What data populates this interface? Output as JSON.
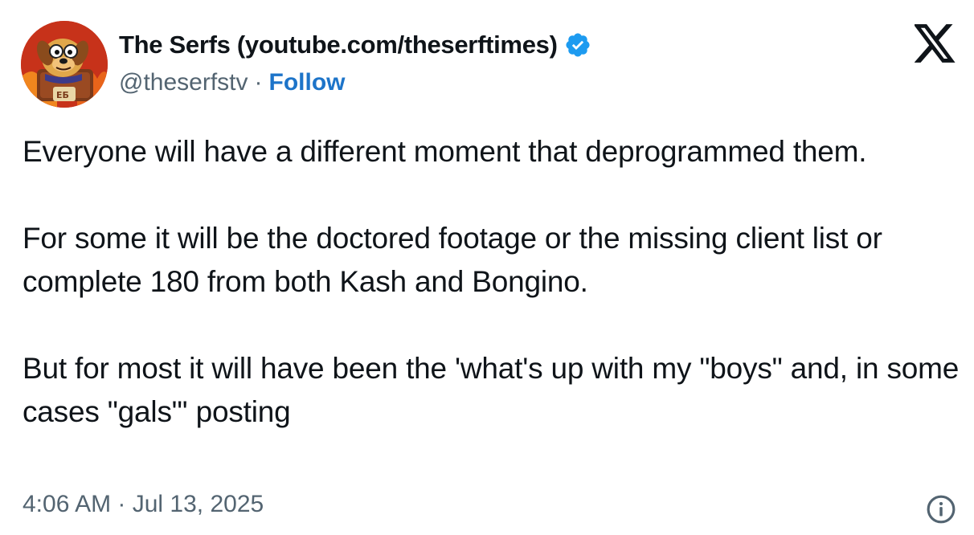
{
  "author": {
    "display_name": "The Serfs (youtube.com/theserftimes)",
    "handle": "@theserfstv",
    "separator": "·",
    "follow_label": "Follow",
    "verified": true
  },
  "post": {
    "paragraphs": [
      "Everyone will have a different moment that deprogrammed them.",
      "For some it will be the doctored footage or the missing client list or complete 180 from both Kash and Bongino.",
      "But for most it will have been the 'what's up with my \"boys\" and, in some cases \"gals\"' posting"
    ],
    "timestamp": "4:06 AM · Jul 13, 2025"
  },
  "icons": {
    "avatar": "cartoon-dog-avatar",
    "verified": "verified-badge-icon",
    "logo": "x-logo-icon",
    "info": "info-icon"
  },
  "colors": {
    "follow": "#1d74c9",
    "verified": "#1d9bf0",
    "muted": "#536471",
    "text": "#0f1419"
  }
}
